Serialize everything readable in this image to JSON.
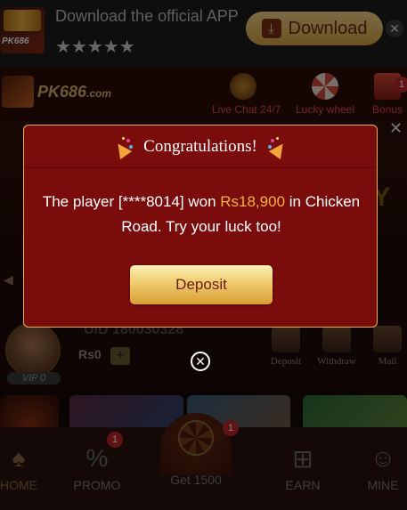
{
  "download_banner": {
    "app_icon_label": "PK686",
    "text": "Download the official APP t...",
    "stars": "★★★★★",
    "button_label": "Download",
    "close": "✕"
  },
  "header": {
    "logo_text": "PK686",
    "logo_suffix": ".com",
    "items": [
      {
        "label": "Live Chat 24/7",
        "icon": "headset-icon"
      },
      {
        "label": "Lucky wheel",
        "icon": "wheel-icon"
      },
      {
        "label": "Bonus",
        "icon": "gift-icon",
        "badge": "1"
      }
    ]
  },
  "user": {
    "uid": "UID 180030328",
    "balance": "Rs0",
    "plus": "+",
    "vip": "VIP 0",
    "actions": [
      {
        "label": "Deposit"
      },
      {
        "label": "Withdraw"
      },
      {
        "label": "Mail"
      }
    ]
  },
  "bottom_nav": {
    "items": [
      {
        "label": "HOME",
        "icon": "spade-icon"
      },
      {
        "label": "PROMO",
        "icon": "coupon-icon",
        "badge": "1"
      },
      {
        "label": "EARN",
        "icon": "gift-box-icon"
      },
      {
        "label": "MINE",
        "icon": "profile-icon"
      }
    ],
    "center": {
      "label": "Get 1500",
      "badge": "1"
    }
  },
  "modal": {
    "title": "Congratulations!",
    "message_prefix": "The player [****8014] won ",
    "amount": "Rs18,900",
    "message_suffix": " in Chicken Road. Try your luck too!",
    "button_label": "Deposit",
    "close": "✕"
  },
  "colors": {
    "modal_bg": "#7a0c0c",
    "modal_border": "#e3b25c",
    "amount": "#f5b342",
    "button_gold": "#f0cf74",
    "button_text": "#6a1a0c"
  }
}
